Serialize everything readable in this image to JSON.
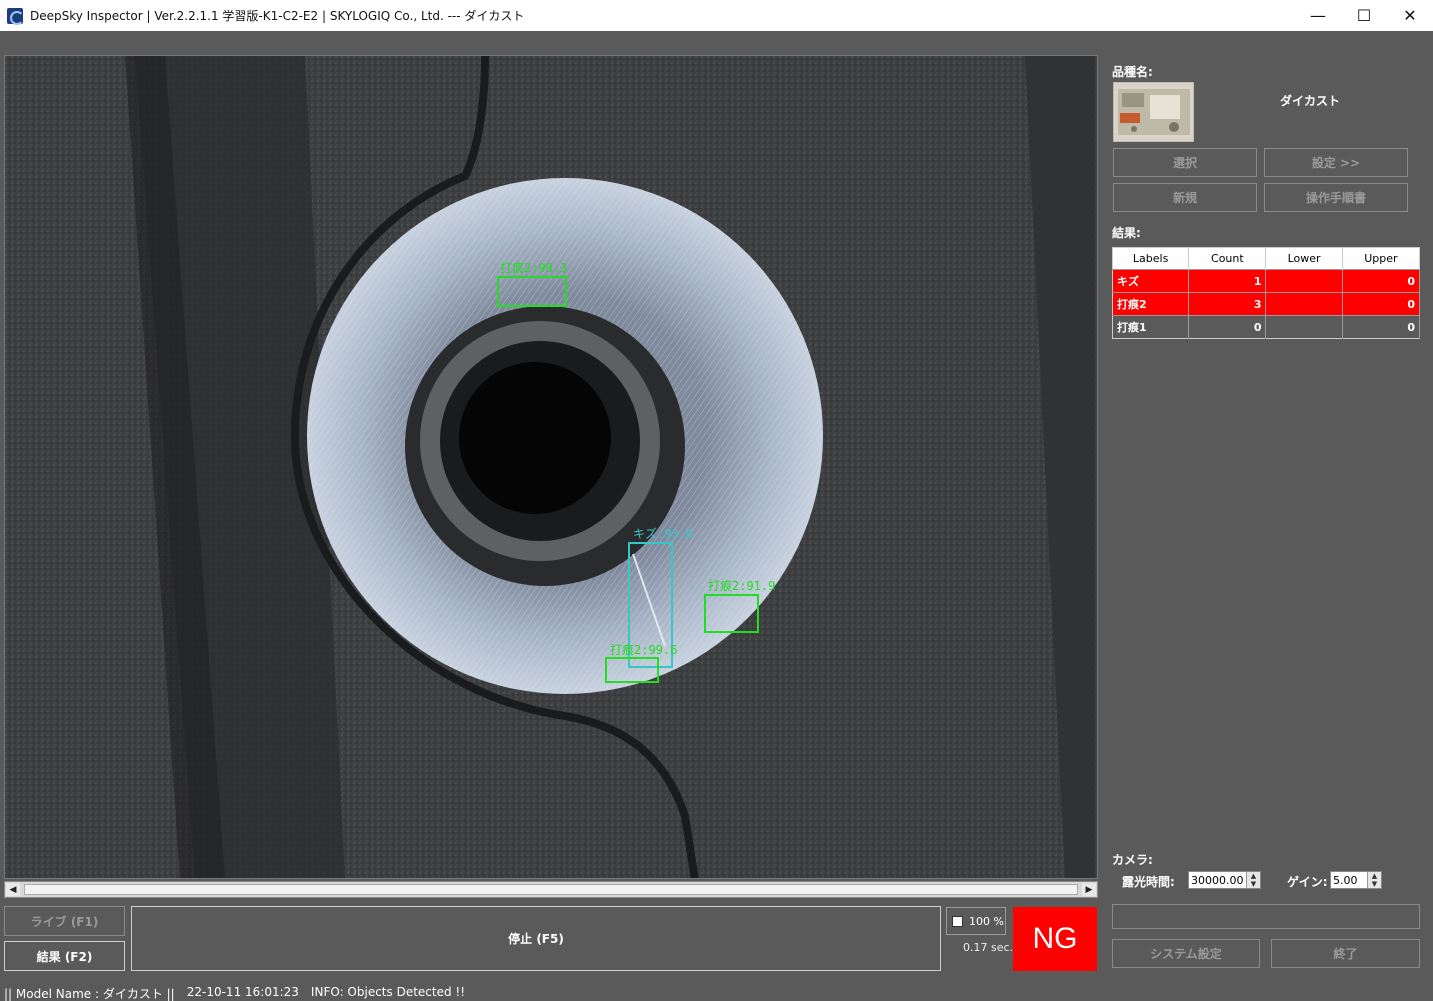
{
  "window": {
    "title": "DeepSky Inspector | Ver.2.2.1.1 学習版-K1-C2-E2 | SKYLOGIQ Co., Ltd. --- ダイカスト",
    "minimize": "—",
    "maximize": "☐",
    "close": "✕"
  },
  "viewer": {
    "detections": [
      {
        "label": "打痕2:99.3",
        "color": "#22dd22"
      },
      {
        "label": "キズ:93.6",
        "color": "#36c8c8"
      },
      {
        "label": "打痕2:91.9",
        "color": "#22dd22"
      },
      {
        "label": "打痕2:99.6",
        "color": "#22dd22"
      }
    ]
  },
  "controls": {
    "live_label": "ライブ (F1)",
    "result_label": "結果 (F2)",
    "stop_label": "停止 (F5)",
    "zoom": "100 %",
    "elapsed": "0.17 sec.",
    "judgement": "NG"
  },
  "panel": {
    "product_label": "品種名:",
    "product_name": "ダイカスト",
    "select_btn": "選択",
    "settings_btn": "設定 >>",
    "new_btn": "新規",
    "manual_btn": "操作手順書",
    "results_label": "結果:",
    "table": {
      "headers": [
        "Labels",
        "Count",
        "Lower",
        "Upper"
      ],
      "rows": [
        [
          "キズ",
          "1",
          "",
          "0"
        ],
        [
          "打痕2",
          "3",
          "",
          "0"
        ],
        [
          "打痕1",
          "0",
          "",
          "0"
        ]
      ]
    },
    "camera_label": "カメラ:",
    "exposure_label": "露光時間:",
    "exposure_value": "30000.00",
    "gain_label": "ゲイン:",
    "gain_value": "5.00",
    "system_btn": "システム設定",
    "exit_btn": "終了"
  },
  "status": {
    "model": "|| Model Name : ダイカスト ||",
    "timestamp": "22-10-11 16:01:23",
    "info": "INFO:   Objects Detected !!"
  }
}
